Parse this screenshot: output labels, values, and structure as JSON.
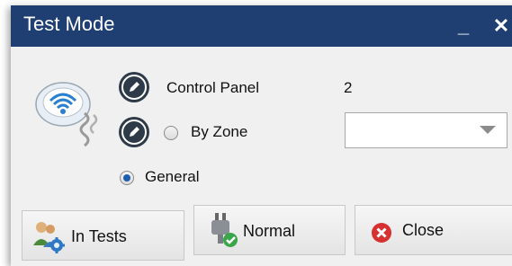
{
  "window": {
    "title": "Test Mode",
    "minimize_glyph": "_",
    "close_glyph": "✕"
  },
  "form": {
    "control_panel_label": "Control Panel",
    "control_panel_value": "2",
    "by_zone_label": "By Zone",
    "general_label": "General",
    "selected_option": "General",
    "zone_dropdown_value": ""
  },
  "buttons": {
    "in_tests": "In Tests",
    "normal": "Normal",
    "close": "Close"
  },
  "icons": {
    "detector": "smoke-detector-icon",
    "edit": "pencil-icon",
    "in_tests": "users-gear-icon",
    "normal": "plug-check-icon",
    "close": "red-x-circle-icon"
  },
  "colors": {
    "titlebar": "#1f3f73",
    "close_icon": "#d63030",
    "check_icon": "#3aa64a",
    "radio_checked": "#1c5fb0"
  }
}
